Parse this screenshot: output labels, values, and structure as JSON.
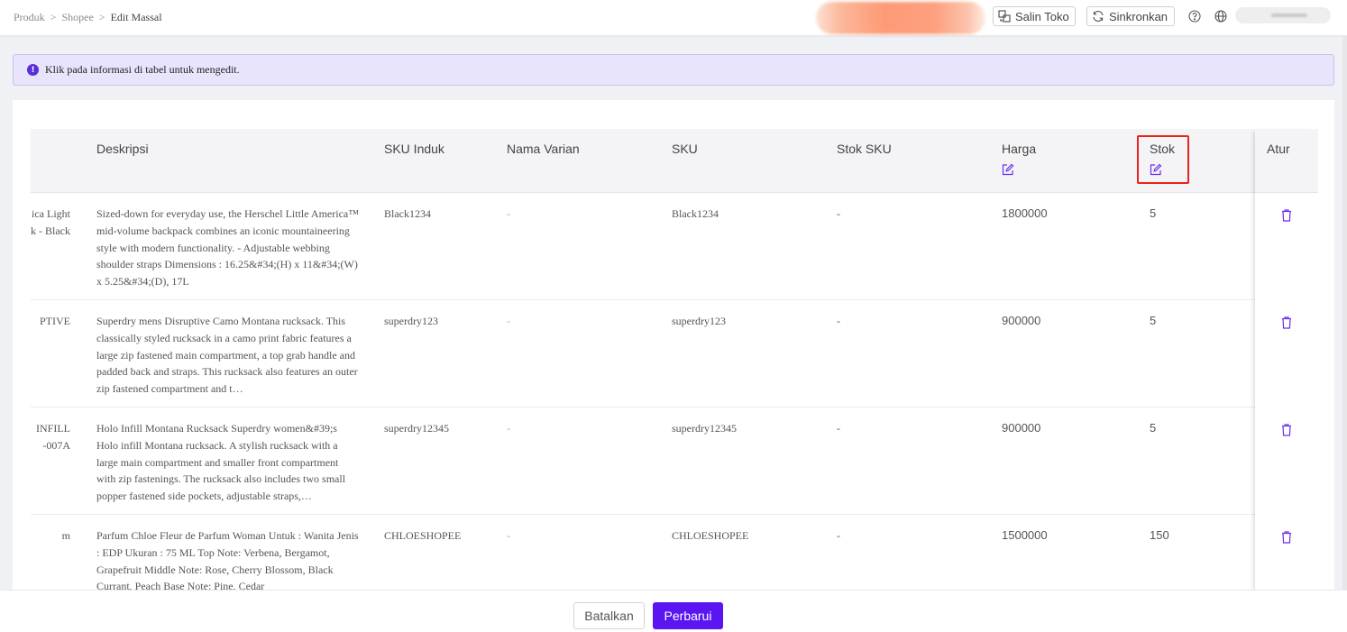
{
  "breadcrumb": [
    "Produk",
    "Shopee",
    "Edit Massal"
  ],
  "breadcrumb_separator": ">",
  "toolbar": {
    "salin_label": "Salin Toko",
    "sinkron_label": "Sinkronkan"
  },
  "info": {
    "text": "Klik pada informasi di tabel untuk mengedit."
  },
  "table": {
    "columns": {
      "deskripsi": "Deskripsi",
      "sku_induk": "SKU Induk",
      "nama_varian": "Nama Varian",
      "sku": "SKU",
      "stok_sku": "Stok SKU",
      "harga": "Harga",
      "stok": "Stok",
      "atur": "Atur"
    },
    "rows": [
      {
        "name_line1": "ica Light",
        "name_line2": "k - Black",
        "desc": "Sized-down for everyday use, the Herschel Little America™ mid-volume backpack combines an iconic mountaineering style with modern functionality. - Adjustable webbing shoulder straps Dimensions : 16.25&#34;(H) x 11&#34;(W) x 5.25&#34;(D), 17L",
        "sku_induk": "Black1234",
        "nama_varian": "-",
        "sku": "Black1234",
        "stok_sku": "-",
        "harga": "1800000",
        "stok": "5"
      },
      {
        "name_line1": "PTIVE",
        "name_line2": "",
        "desc": "Superdry mens Disruptive Camo Montana rucksack. This classically styled rucksack in a camo print fabric features a large zip fastened main compartment, a top grab handle and padded back and straps. This rucksack also features an outer zip fastened compartment and t…",
        "sku_induk": "superdry123",
        "nama_varian": "-",
        "sku": "superdry123",
        "stok_sku": "-",
        "harga": "900000",
        "stok": "5"
      },
      {
        "name_line1": "INFILL",
        "name_line2": "007A-",
        "desc": "Holo Infill Montana Rucksack Superdry women&#39;s Holo infill Montana rucksack. A stylish rucksack with a large main compartment and smaller front compartment with zip fastenings. The rucksack also includes two small popper fastened side pockets, adjustable straps,…",
        "sku_induk": "superdry12345",
        "nama_varian": "-",
        "sku": "superdry12345",
        "stok_sku": "-",
        "harga": "900000",
        "stok": "5"
      },
      {
        "name_line1": "m",
        "name_line2": "",
        "desc": "Parfum Chloe Fleur de Parfum Woman Untuk : Wanita Jenis : EDP Ukuran : 75 ML Top Note: Verbena, Bergamot, Grapefruit Middle Note: Rose, Cherry Blossom, Black Currant, Peach Base Note: Pine, Cedar",
        "sku_induk": "CHLOESHOPEE",
        "nama_varian": "-",
        "sku": "CHLOESHOPEE",
        "stok_sku": "-",
        "harga": "1500000",
        "stok": "150"
      }
    ]
  },
  "footer": {
    "cancel_label": "Batalkan",
    "update_label": "Perbarui"
  },
  "colors": {
    "accent": "#5a15f0",
    "highlight": "#e8231a",
    "banner_bg": "#e8e4fc"
  }
}
